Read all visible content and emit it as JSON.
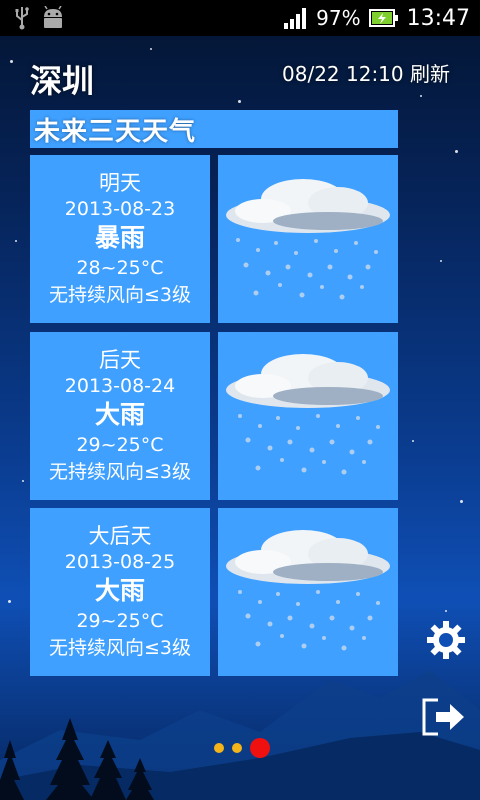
{
  "status_bar": {
    "battery_percent": "97%",
    "time": "13:47",
    "icons": [
      "usb-icon",
      "android-debug-icon",
      "signal-icon",
      "battery-charging-icon"
    ]
  },
  "header": {
    "city": "深圳",
    "updated": "08/22 12:10 刷新"
  },
  "section_title": "未来三天天气",
  "forecast": [
    {
      "day": "明天",
      "date": "2013-08-23",
      "weather": "暴雨",
      "temp": "28~25°C",
      "wind": "无持续风向≤3级",
      "icon": "rain-cloud-icon"
    },
    {
      "day": "后天",
      "date": "2013-08-24",
      "weather": "大雨",
      "temp": "29~25°C",
      "wind": "无持续风向≤3级",
      "icon": "rain-cloud-icon"
    },
    {
      "day": "大后天",
      "date": "2013-08-25",
      "weather": "大雨",
      "temp": "29~25°C",
      "wind": "无持续风向≤3级",
      "icon": "rain-cloud-icon"
    }
  ],
  "side_buttons": [
    "settings-icon",
    "exit-icon"
  ],
  "page_indicator": {
    "count": 3,
    "active": 3
  },
  "colors": {
    "card": "#3fa0ff",
    "dot": "#f3b51a",
    "dot_active": "#f01010"
  }
}
